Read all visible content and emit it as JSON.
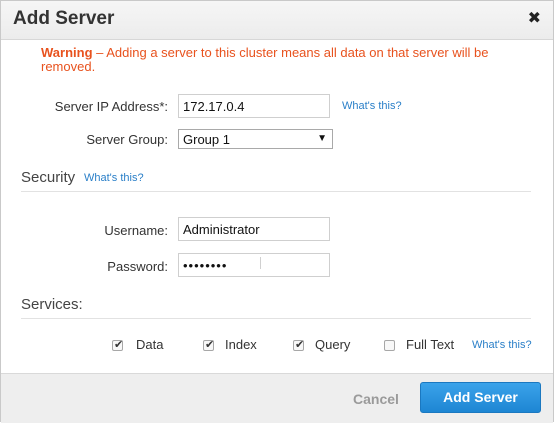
{
  "dialog": {
    "title": "Add Server",
    "close_glyph": "✖"
  },
  "warning": {
    "strong": "Warning",
    "text": " – Adding a server to this cluster means all data on that server will be removed."
  },
  "server": {
    "ip_label": "Server IP Address*:",
    "ip_value": "172.17.0.4",
    "ip_help": "What's this?",
    "group_label": "Server Group:",
    "group_value": "Group 1",
    "group_arrow": "▼"
  },
  "security": {
    "title": "Security",
    "help": "What's this?",
    "username_label": "Username:",
    "username_value": "Administrator",
    "password_label": "Password:",
    "password_value": "••••••••"
  },
  "services": {
    "title": "Services:",
    "items": [
      {
        "label": "Data",
        "checked": true
      },
      {
        "label": "Index",
        "checked": true
      },
      {
        "label": "Query",
        "checked": true
      },
      {
        "label": "Full Text",
        "checked": false
      }
    ],
    "help": "What's this?"
  },
  "footer": {
    "cancel_label": "Cancel",
    "submit_label": "Add Server"
  },
  "colors": {
    "warning": "#e8521e",
    "link": "#2a7fc8",
    "primary": "#2a95e0"
  },
  "icons": {
    "close": "close-icon",
    "dropdown": "chevron-down-icon",
    "checkbox_tick": "checkmark-icon"
  }
}
